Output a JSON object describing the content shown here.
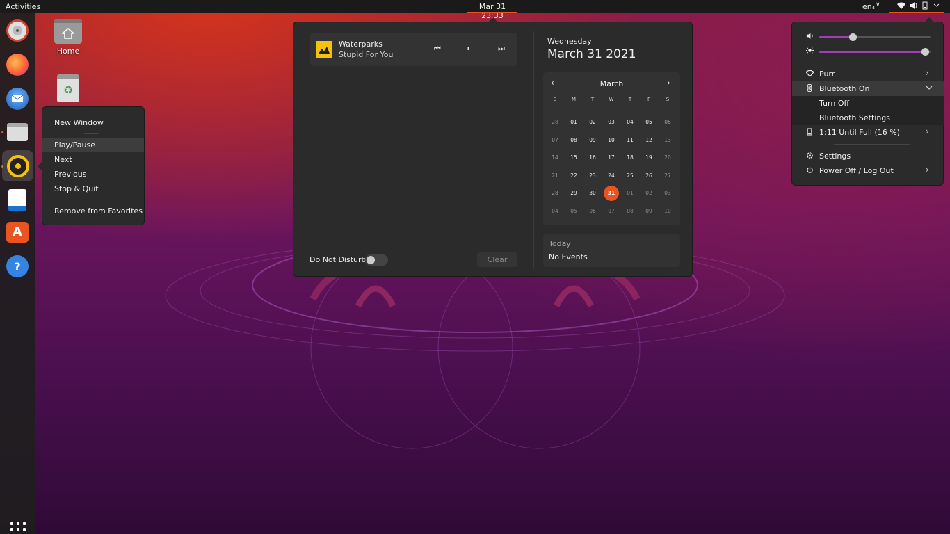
{
  "topbar": {
    "activities": "Activities",
    "clock": "Mar 31  23:33",
    "input_source": "en₄",
    "input_arrow": "∨"
  },
  "desktop": {
    "home_label": "Home"
  },
  "context_menu": {
    "items": [
      "New Window",
      "Play/Pause",
      "Next",
      "Previous",
      "Stop & Quit",
      "Remove from Favorites"
    ]
  },
  "media": {
    "artist": "Waterparks",
    "track": "Stupid For You",
    "prev_symbol": "⏮",
    "pause_symbol": "⏸",
    "next_symbol": "⏭"
  },
  "notifications": {
    "dnd_label": "Do Not Disturb",
    "dnd_enabled": false,
    "clear_label": "Clear"
  },
  "calendar": {
    "weekday": "Wednesday",
    "full_date": "March 31 2021",
    "month": "March",
    "prev_symbol": "‹",
    "next_symbol": "›",
    "days_of_week": [
      "S",
      "M",
      "T",
      "W",
      "T",
      "F",
      "S"
    ],
    "weeks": [
      [
        "28",
        "01",
        "02",
        "03",
        "04",
        "05",
        "06"
      ],
      [
        "07",
        "08",
        "09",
        "10",
        "11",
        "12",
        "13"
      ],
      [
        "14",
        "15",
        "16",
        "17",
        "18",
        "19",
        "20"
      ],
      [
        "21",
        "22",
        "23",
        "24",
        "25",
        "26",
        "27"
      ],
      [
        "28",
        "29",
        "30",
        "31",
        "01",
        "02",
        "03"
      ],
      [
        "04",
        "05",
        "06",
        "07",
        "08",
        "09",
        "10"
      ]
    ],
    "today": "31",
    "events_title": "Today",
    "events_text": "No Events"
  },
  "system_menu": {
    "volume_level": 0.3,
    "brightness_level": 0.95,
    "wifi_label": "Purr",
    "bluetooth_label": "Bluetooth On",
    "bt_turn_off": "Turn Off",
    "bt_settings": "Bluetooth Settings",
    "battery_label": "1:11 Until Full (16 %)",
    "settings_label": "Settings",
    "power_label": "Power Off / Log Out"
  },
  "colors": {
    "accent": "#e95420",
    "slider": "#a23cb7",
    "panel": "#2b2b2b"
  }
}
